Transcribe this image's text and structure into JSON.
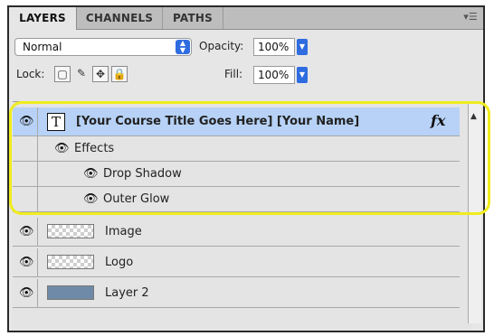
{
  "tabs": [
    {
      "label": "LAYERS"
    },
    {
      "label": "CHANNELS"
    },
    {
      "label": "PATHS"
    }
  ],
  "panel_menu_icon": "panel-menu-icon",
  "blend_mode": {
    "value": "Normal"
  },
  "opacity": {
    "label": "Opacity:",
    "value": "100%"
  },
  "lock": {
    "label": "Lock:",
    "icons": [
      "lock-transparent-pixels-icon",
      "lock-image-pixels-icon",
      "lock-position-icon",
      "lock-all-icon"
    ]
  },
  "fill": {
    "label": "Fill:",
    "value": "100%"
  },
  "layers": {
    "text_layer": {
      "name": "[Your Course Title Goes Here] [Your Name]",
      "fx": "fx",
      "thumb_glyph": "T"
    },
    "effects": {
      "label": "Effects"
    },
    "effect_items": [
      {
        "label": "Drop Shadow"
      },
      {
        "label": "Outer Glow"
      }
    ],
    "image_layer": {
      "name": "Image"
    },
    "logo_layer": {
      "name": "Logo"
    },
    "layer2": {
      "name": "Layer 2"
    }
  },
  "colors": {
    "selection": "#b7d2f6",
    "highlight_outline": "#f0ec1e",
    "control_accent": "#2f6ce0"
  }
}
